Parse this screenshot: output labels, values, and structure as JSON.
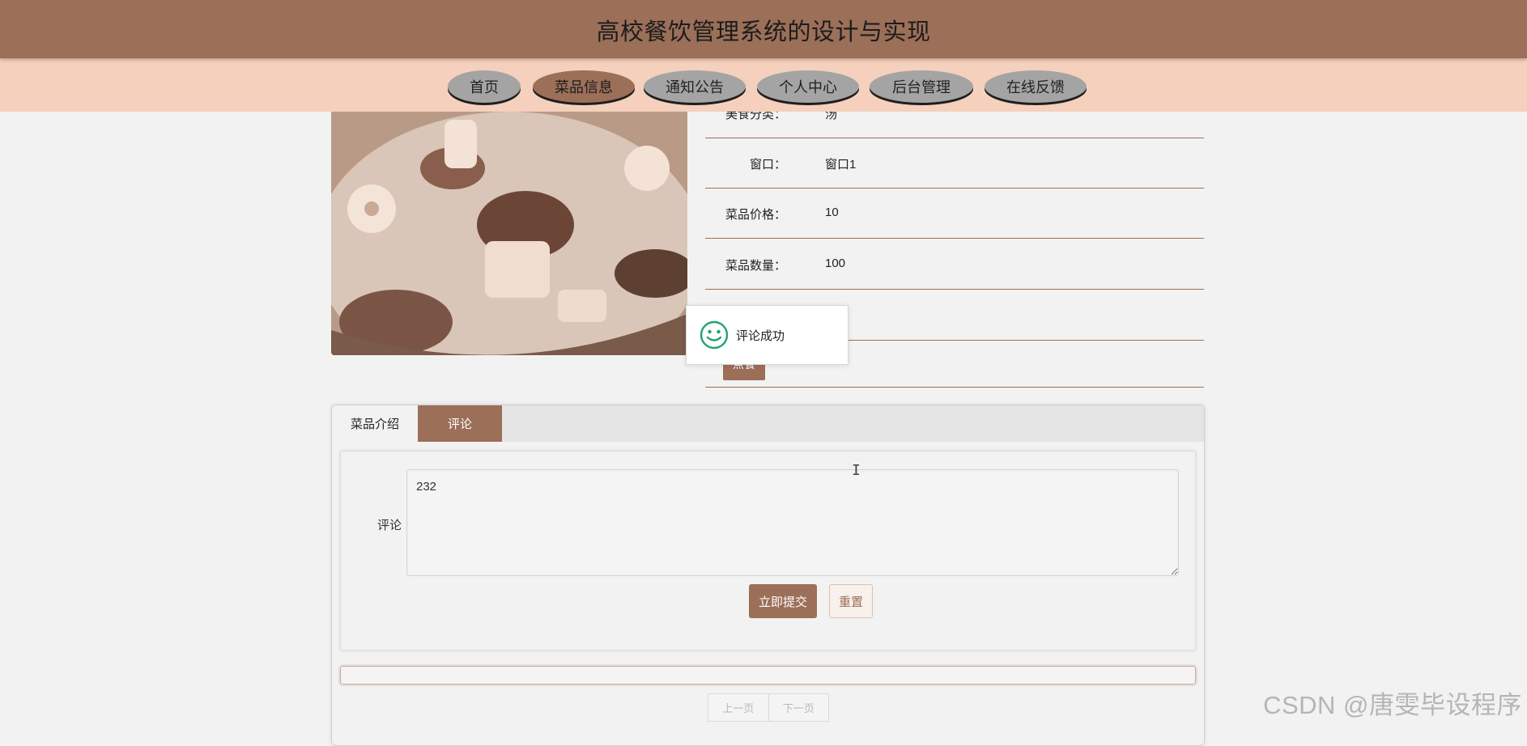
{
  "header": {
    "title": "高校餐饮管理系统的设计与实现"
  },
  "nav": {
    "items": [
      {
        "label": "首页",
        "active": false
      },
      {
        "label": "菜品信息",
        "active": true
      },
      {
        "label": "通知公告",
        "active": false
      },
      {
        "label": "个人中心",
        "active": false
      },
      {
        "label": "后台管理",
        "active": false
      },
      {
        "label": "在线反馈",
        "active": false
      }
    ]
  },
  "dish": {
    "info": [
      {
        "label": "美食分类：",
        "value": "汤"
      },
      {
        "label": "窗口：",
        "value": "窗口1"
      },
      {
        "label": "菜品价格：",
        "value": "10"
      },
      {
        "label": "菜品数量：",
        "value": "100"
      }
    ],
    "order_label": "点餐"
  },
  "toast": {
    "message": "评论成功"
  },
  "tabs": [
    {
      "label": "菜品介绍",
      "active": false
    },
    {
      "label": "评论",
      "active": true
    }
  ],
  "comment_form": {
    "label": "评论",
    "value": "232",
    "submit_label": "立即提交",
    "reset_label": "重置"
  },
  "pager": {
    "prev_label": "上一页",
    "next_label": "下一页"
  },
  "watermark": "CSDN @唐雯毕设程序",
  "colors": {
    "brand": "#9b6f58",
    "nav_bg": "#f5d0bc",
    "page_bg": "#f2f2f2",
    "success": "#20a36e"
  }
}
